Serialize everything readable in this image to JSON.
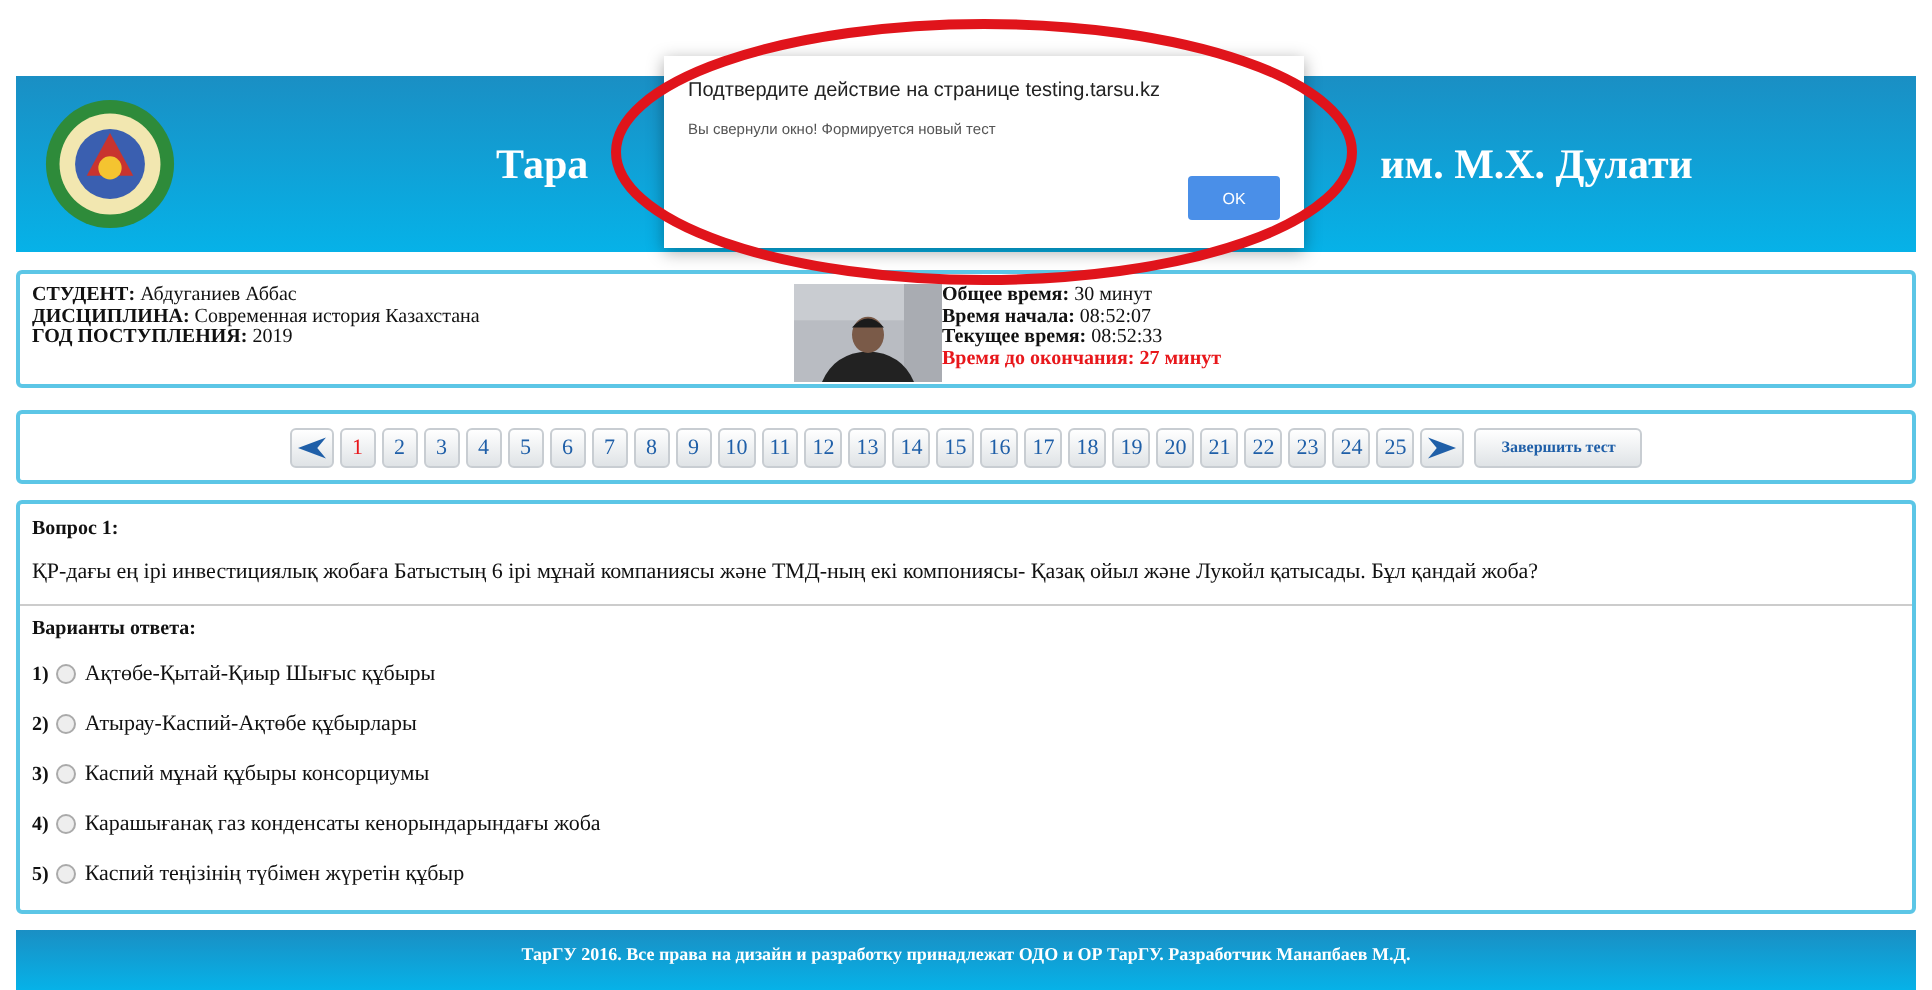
{
  "header": {
    "title_start": "Тара",
    "title_end": "им. М.Х. Дулати"
  },
  "student": {
    "fields": [
      {
        "label": "СТУДЕНТ:",
        "value": "Абдуганиев Аббас"
      },
      {
        "label": "ДИСЦИПЛИНА:",
        "value": "Современная история Казахстана"
      },
      {
        "label": "ГОД ПОСТУПЛЕНИЯ:",
        "value": "2019"
      }
    ],
    "timing": [
      {
        "label": "Общее время:",
        "value": "30 минут",
        "kind": "normal"
      },
      {
        "label": "Время начала:",
        "value": "08:52:07",
        "kind": "normal"
      },
      {
        "label": "Текущее время:",
        "value": "08:52:33",
        "kind": "normal"
      },
      {
        "label": "Время до окончания:",
        "value": "27 минут",
        "kind": "alert"
      }
    ]
  },
  "nav": {
    "pages": [
      {
        "label": "1",
        "selected": true
      },
      {
        "label": "2",
        "selected": false
      },
      {
        "label": "3",
        "selected": false
      },
      {
        "label": "4",
        "selected": false
      },
      {
        "label": "5",
        "selected": false
      },
      {
        "label": "6",
        "selected": false
      },
      {
        "label": "7",
        "selected": false
      },
      {
        "label": "8",
        "selected": false
      },
      {
        "label": "9",
        "selected": false
      },
      {
        "label": "10",
        "selected": false
      },
      {
        "label": "11",
        "selected": false
      },
      {
        "label": "12",
        "selected": false
      },
      {
        "label": "13",
        "selected": false
      },
      {
        "label": "14",
        "selected": false
      },
      {
        "label": "15",
        "selected": false
      },
      {
        "label": "16",
        "selected": false
      },
      {
        "label": "17",
        "selected": false
      },
      {
        "label": "18",
        "selected": false
      },
      {
        "label": "19",
        "selected": false
      },
      {
        "label": "20",
        "selected": false
      },
      {
        "label": "21",
        "selected": false
      },
      {
        "label": "22",
        "selected": false
      },
      {
        "label": "23",
        "selected": false
      },
      {
        "label": "24",
        "selected": false
      },
      {
        "label": "25",
        "selected": false
      }
    ],
    "finish": "Завершить тест"
  },
  "question": {
    "title": "Вопрос 1:",
    "text": "ҚР-дағы ең ірі инвестициялық жобаға Батыстың 6 ірі мұнай компаниясы және ТМД-ның екі компониясы- Қазақ ойыл және Лукойл қатысады. Бұл қандай жоба?",
    "answers_title": "Варианты ответа:",
    "answers": [
      {
        "number": "1)",
        "text": "Ақтөбе-Қытай-Қиыр Шығыс құбыры",
        "selected": false
      },
      {
        "number": "2)",
        "text": "Атырау-Каспий-Ақтөбе құбырлары",
        "selected": false
      },
      {
        "number": "3)",
        "text": "Каспий мұнай құбыры консорциумы",
        "selected": false
      },
      {
        "number": "4)",
        "text": "Карашығанақ газ конденсаты кенорындарындағы жоба",
        "selected": false
      },
      {
        "number": "5)",
        "text": "Каспий теңізінің түбімен жүретін құбыр",
        "selected": false
      }
    ]
  },
  "footer": "ТарГУ 2016. Все права на дизайн и разработку принадлежат ОДО и ОР ТарГУ. Разработчик Манапбаев М.Д.",
  "dialog": {
    "title": "Подтвердите действие на странице testing.tarsu.kz",
    "message": "Вы свернули окно! Формируется новый тест",
    "button": "OK"
  }
}
